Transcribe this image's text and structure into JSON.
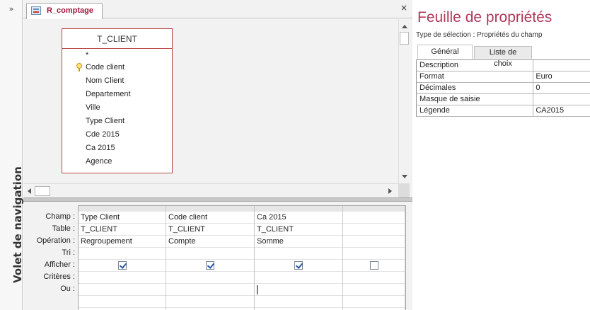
{
  "nav": {
    "toggle": "»",
    "label": "Volet de navigation"
  },
  "document": {
    "tab_label": "R_comptage",
    "close": "×"
  },
  "table": {
    "title": "T_CLIENT",
    "fields": [
      "*",
      "Code client",
      "Nom Client",
      "Departement",
      "Ville",
      "Type Client",
      "Cde 2015",
      "Ca 2015",
      "Agence"
    ]
  },
  "qbe": {
    "row_labels": [
      "Champ :",
      "Table :",
      "Opération :",
      "Tri :",
      "Afficher :",
      "Critères :",
      "Ou :"
    ],
    "columns": [
      {
        "field": "Type Client",
        "table": "T_CLIENT",
        "operation": "Regroupement",
        "show": true
      },
      {
        "field": "Code client",
        "table": "T_CLIENT",
        "operation": "Compte",
        "show": true
      },
      {
        "field": "Ca 2015",
        "table": "T_CLIENT",
        "operation": "Somme",
        "show": true
      },
      {
        "field": "",
        "table": "",
        "operation": "",
        "show": false
      }
    ]
  },
  "property_sheet": {
    "title": "Feuille de propriétés",
    "subtitle": "Type de sélection : Propriétés du champ",
    "tabs": [
      "Général",
      "Liste de choix"
    ],
    "rows": [
      {
        "name": "Description",
        "value": ""
      },
      {
        "name": "Format",
        "value": "Euro"
      },
      {
        "name": "Décimales",
        "value": "0"
      },
      {
        "name": "Masque de saisie",
        "value": ""
      },
      {
        "name": "Légende",
        "value": "CA2015"
      }
    ]
  },
  "colors": {
    "accent": "#b1385a",
    "table_border": "#b84a4a",
    "tab_label": "#a0143a"
  }
}
